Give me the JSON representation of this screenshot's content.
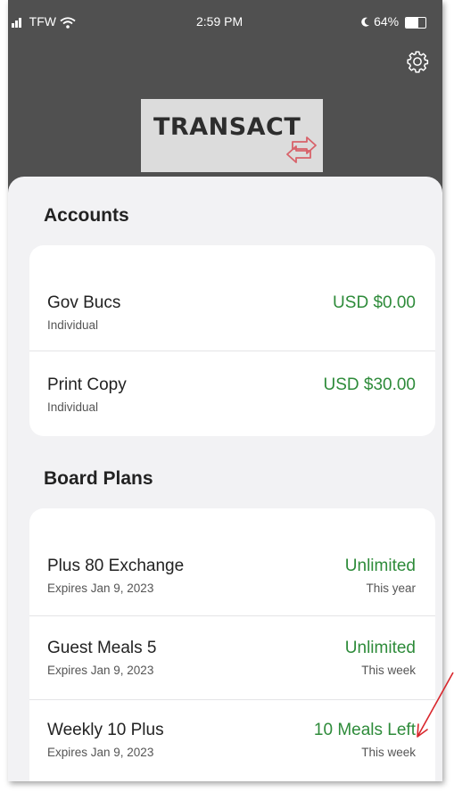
{
  "status_bar": {
    "carrier": "TFW",
    "time": "2:59 PM",
    "battery": "64%",
    "battery_level": 0.64
  },
  "header": {
    "logo_text": "TRANSACT",
    "settings_icon": "gear-icon"
  },
  "accounts": {
    "title": "Accounts",
    "items": [
      {
        "name": "Gov Bucs",
        "type": "Individual",
        "balance": "USD $0.00"
      },
      {
        "name": "Print Copy",
        "type": "Individual",
        "balance": "USD $30.00"
      }
    ]
  },
  "board_plans": {
    "title": "Board Plans",
    "items": [
      {
        "name": "Plus 80 Exchange",
        "expires": "Expires Jan 9, 2023",
        "remaining": "Unlimited",
        "period": "This year"
      },
      {
        "name": "Guest Meals 5",
        "expires": "Expires Jan 9, 2023",
        "remaining": "Unlimited",
        "period": "This week"
      },
      {
        "name": "Weekly 10 Plus",
        "expires": "Expires Jan 9, 2023",
        "remaining": "10 Meals Left",
        "period": "This week"
      }
    ]
  },
  "colors": {
    "header_bg": "#505050",
    "balance_green": "#2e8b3a",
    "annotation_red": "#d9262c",
    "logo_accent": "#d8626a"
  }
}
